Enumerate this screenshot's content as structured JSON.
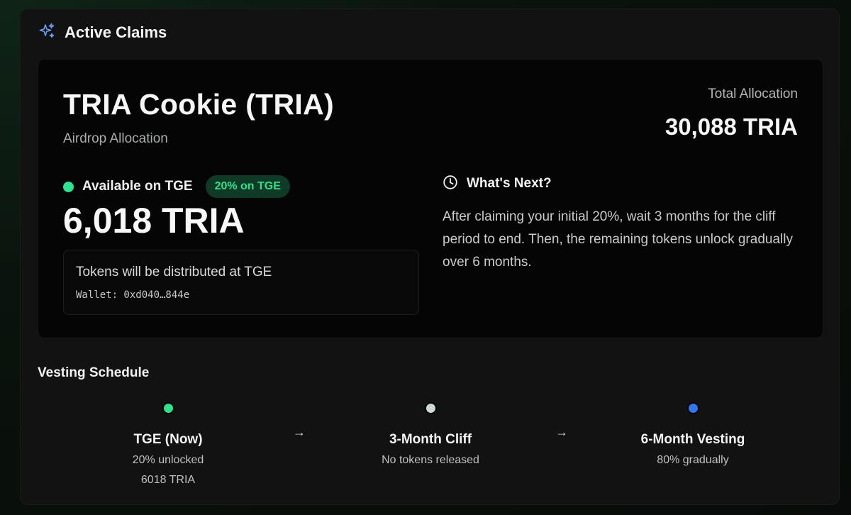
{
  "header": {
    "title": "Active Claims",
    "icon": "sparkles-icon"
  },
  "claim": {
    "token_name": "TRIA Cookie (TRIA)",
    "subtitle": "Airdrop Allocation",
    "total_label": "Total Allocation",
    "total_value": "30,088 TRIA",
    "available_label": "Available on TGE",
    "badge": "20% on TGE",
    "available_amount": "6,018 TRIA",
    "distribution_text": "Tokens will be distributed at TGE",
    "wallet_text": "Wallet: 0xd040…844e"
  },
  "whats_next": {
    "title": "What's Next?",
    "icon": "clock-icon",
    "body": "After claiming your initial 20%, wait 3 months for the cliff period to end. Then, the remaining tokens unlock gradually over 6 months."
  },
  "vesting": {
    "title": "Vesting Schedule",
    "arrow": "→",
    "steps": [
      {
        "title": "TGE (Now)",
        "line1": "20% unlocked",
        "line2": "6018 TRIA",
        "color": "#2ee38e"
      },
      {
        "title": "3-Month Cliff",
        "line1": "No tokens released",
        "line2": "",
        "color": "#cfd8d4"
      },
      {
        "title": "6-Month Vesting",
        "line1": "80% gradually",
        "line2": "",
        "color": "#2f78f0"
      }
    ]
  },
  "colors": {
    "accent_green": "#2ee38e",
    "accent_blue": "#2f78f0",
    "badge_bg": "#0f3a26"
  }
}
